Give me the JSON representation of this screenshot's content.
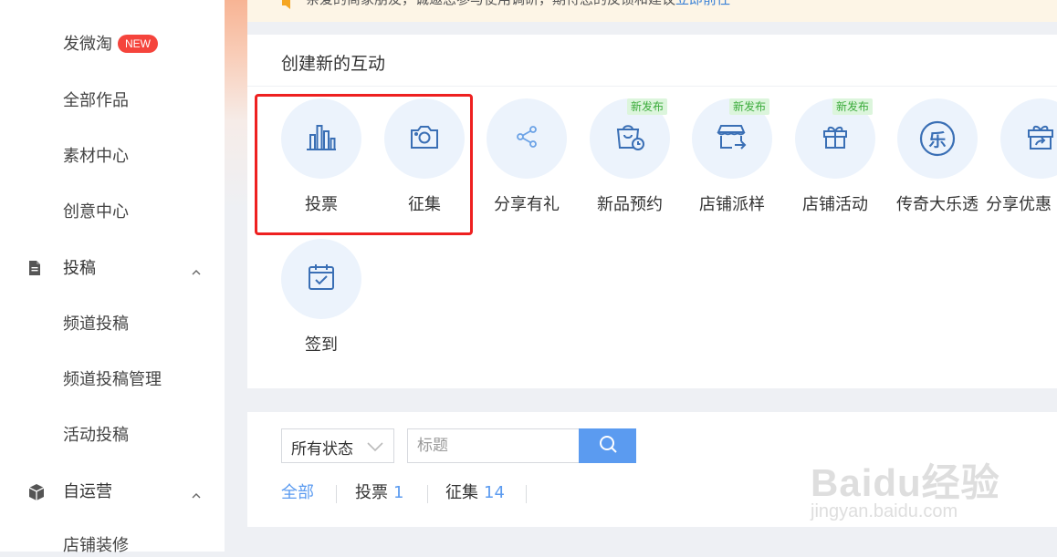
{
  "notice": {
    "text": "亲爱的商家朋友，诚邀您参与使用调研，期待您的反馈和建议",
    "link": "立即前往"
  },
  "sidebar": {
    "items_top": [
      {
        "label": "发微淘",
        "badge": "NEW"
      },
      {
        "label": "全部作品"
      },
      {
        "label": "素材中心"
      },
      {
        "label": "创意中心"
      }
    ],
    "group_submit": {
      "label": "投稿",
      "icon": "document-icon"
    },
    "items_submit": [
      {
        "label": "频道投稿"
      },
      {
        "label": "频道投稿管理"
      },
      {
        "label": "活动投稿"
      }
    ],
    "group_self": {
      "label": "自运营",
      "icon": "cube-icon"
    },
    "items_self": [
      {
        "label": "店铺装修"
      }
    ]
  },
  "interactions": {
    "title": "创建新的互动",
    "new_tag": "新发布",
    "tiles": [
      {
        "label": "投票",
        "icon": "bar-chart-icon",
        "is_new": false
      },
      {
        "label": "征集",
        "icon": "camera-icon",
        "is_new": false
      },
      {
        "label": "分享有礼",
        "icon": "share-icon",
        "is_new": false
      },
      {
        "label": "新品预约",
        "icon": "shopping-bag-clock-icon",
        "is_new": true
      },
      {
        "label": "店铺派样",
        "icon": "store-arrow-icon",
        "is_new": true
      },
      {
        "label": "店铺活动",
        "icon": "gift-icon",
        "is_new": true
      },
      {
        "label": "传奇大乐透",
        "icon": "le-circle-icon",
        "is_new": false
      },
      {
        "label": "分享优惠",
        "icon": "gift-share-icon",
        "is_new": false
      },
      {
        "label": "签到",
        "icon": "calendar-check-icon",
        "is_new": false
      }
    ],
    "le_glyph": "乐"
  },
  "filter": {
    "status_value": "所有状态",
    "title_placeholder": "标题",
    "tabs": [
      {
        "label": "全部",
        "count": null,
        "active": true
      },
      {
        "label": "投票",
        "count": "1",
        "active": false
      },
      {
        "label": "征集",
        "count": "14",
        "active": false
      }
    ]
  },
  "watermark": {
    "logo": "Baidu经验",
    "url": "jingyan.baidu.com"
  },
  "colors": {
    "accent": "#5b9bf0",
    "icon_blue": "#3a6fb5",
    "highlight_red": "#ee2020",
    "new_badge": "#f5443c",
    "new_tag_bg": "#dcf5dc",
    "new_tag_fg": "#3bab3b",
    "tile_bg": "#ecf3fc"
  }
}
